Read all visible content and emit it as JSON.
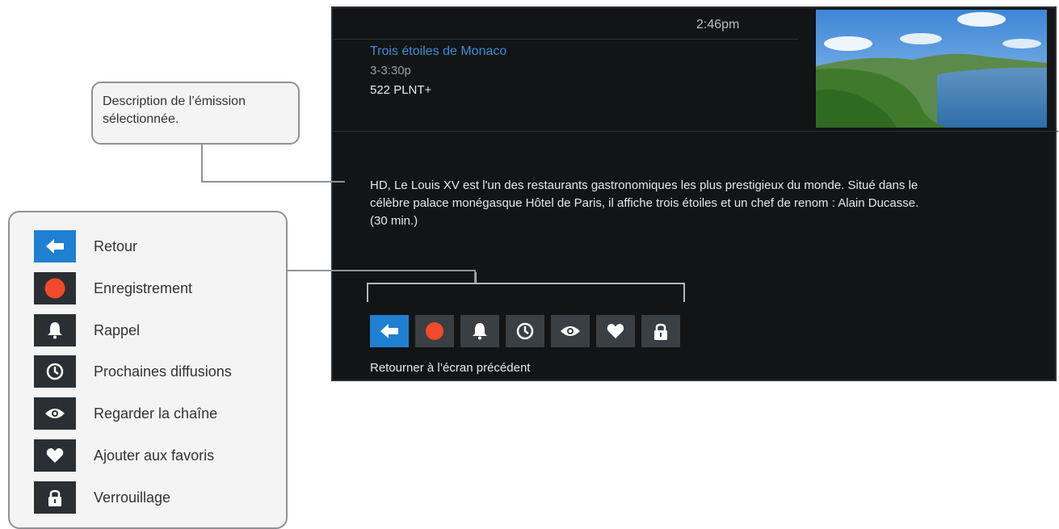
{
  "tv": {
    "clock": "2:46pm",
    "program": {
      "title": "Trois étoiles de Monaco",
      "time": "3-3:30p",
      "channel": "522 PLNT+"
    },
    "description_lines": [
      "HD, Le Louis XV est l'un des restaurants gastronomiques les plus prestigieux du monde. Situé dans le",
      "célèbre palace monégasque Hôtel de Paris, il affiche trois étoiles et un chef de renom : Alain Ducasse.",
      "(30 min.)"
    ],
    "action_buttons": [
      {
        "icon": "back-arrow-icon",
        "active": true
      },
      {
        "icon": "record-icon",
        "active": false
      },
      {
        "icon": "bell-icon",
        "active": false
      },
      {
        "icon": "clock-icon",
        "active": false
      },
      {
        "icon": "eye-icon",
        "active": false
      },
      {
        "icon": "heart-icon",
        "active": false
      },
      {
        "icon": "lock-icon",
        "active": false
      }
    ],
    "status_text": "Retourner à l’écran précédent"
  },
  "callout": {
    "lines": [
      "Description de l’émission",
      "sélectionnée."
    ]
  },
  "legend": {
    "items": [
      {
        "icon": "back-arrow-icon",
        "label": "Retour"
      },
      {
        "icon": "record-icon",
        "label": "Enregistrement"
      },
      {
        "icon": "bell-icon",
        "label": "Rappel"
      },
      {
        "icon": "clock-icon",
        "label": "Prochaines diffusions"
      },
      {
        "icon": "eye-icon",
        "label": "Regarder la chaîne"
      },
      {
        "icon": "heart-icon",
        "label": "Ajouter aux favoris"
      },
      {
        "icon": "lock-icon",
        "label": "Verrouillage"
      }
    ]
  },
  "colors": {
    "accent_blue": "#1f7fd1",
    "title_blue": "#3c8fd6",
    "record_red": "#f04a2a",
    "tv_background": "#121416"
  }
}
